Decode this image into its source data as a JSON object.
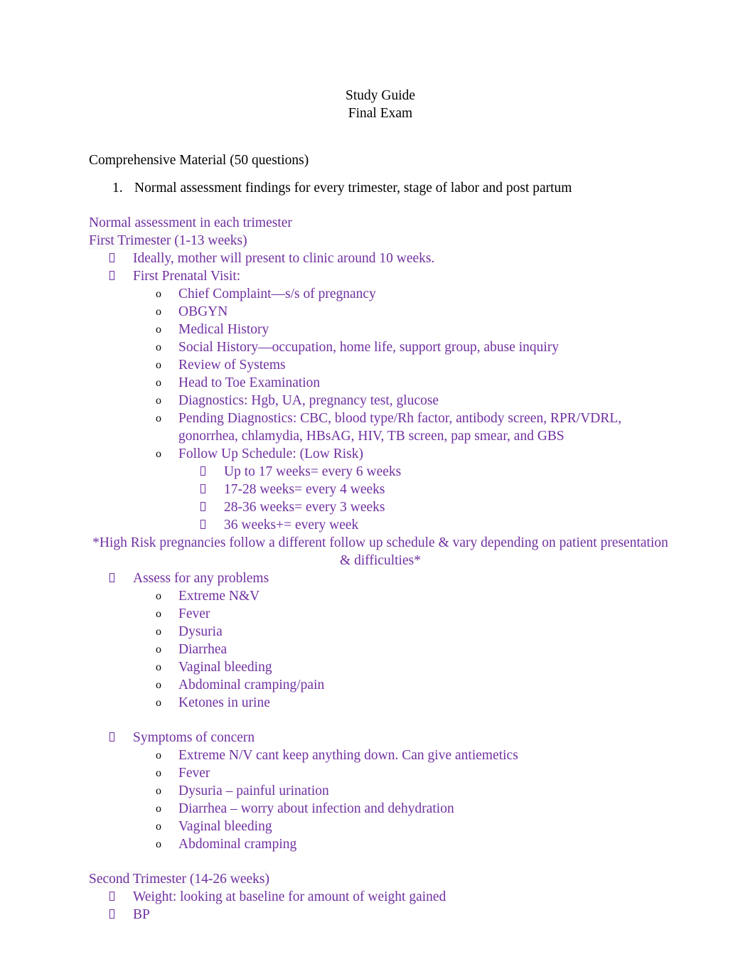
{
  "document": {
    "title_lines": [
      "Study Guide",
      "Final Exam"
    ],
    "section_heading": "Comprehensive Material (50 questions)",
    "numbered_items": [
      {
        "number": "1.",
        "text": "Normal assessment findings for every trimester, stage of labor and post partum"
      }
    ],
    "colors": {
      "body_text": "#000000",
      "purple_text": "#7030A0",
      "page_background": "#ffffff",
      "shading": "#fafafa"
    },
    "bullet_glyphs": {
      "level1": "missing-glyph-box",
      "level2": "o",
      "level3": "missing-glyph-box"
    },
    "outline": {
      "intro_heading": "Normal assessment in each trimester",
      "first_trimester": {
        "heading": "First Trimester (1-13 weeks)",
        "items": [
          {
            "level": 1,
            "text": "Ideally, mother will present to clinic around 10 weeks."
          },
          {
            "level": 1,
            "text": "First Prenatal Visit:"
          },
          {
            "level": 2,
            "text": "Chief Complaint—s/s of pregnancy"
          },
          {
            "level": 2,
            "text": "OBGYN"
          },
          {
            "level": 2,
            "text": "Medical History"
          },
          {
            "level": 2,
            "text": "Social History—occupation, home life, support group, abuse inquiry"
          },
          {
            "level": 2,
            "text": "Review of Systems"
          },
          {
            "level": 2,
            "text": "Head to Toe Examination"
          },
          {
            "level": 2,
            "text": "Diagnostics: Hgb, UA, pregnancy test, glucose"
          },
          {
            "level": 2,
            "text": "Pending Diagnostics: CBC, blood type/Rh factor, antibody screen, RPR/VDRL, gonorrhea, chlamydia, HBsAG, HIV, TB screen, pap smear, and GBS"
          },
          {
            "level": 2,
            "text": "Follow Up Schedule: (Low Risk)"
          },
          {
            "level": 3,
            "text": "Up to 17 weeks= every 6 weeks"
          },
          {
            "level": 3,
            "text": "17-28 weeks= every 4 weeks"
          },
          {
            "level": 3,
            "text": "28-36 weeks= every 3 weeks"
          },
          {
            "level": 3,
            "text": "36 weeks+= every week"
          }
        ],
        "high_risk_note": "*High Risk pregnancies follow a different follow up schedule & vary depending on patient presentation & difficulties*",
        "assess_heading": "Assess for any problems",
        "assess_items": [
          "Extreme N&V",
          "Fever",
          "Dysuria",
          "Diarrhea",
          "Vaginal bleeding",
          "Abdominal cramping/pain",
          "Ketones in urine"
        ],
        "symptoms_heading": "Symptoms of concern",
        "symptoms_items": [
          "Extreme N/V cant keep anything down. Can give antiemetics",
          "Fever",
          "Dysuria – painful urination",
          "Diarrhea – worry about infection and dehydration",
          "Vaginal bleeding",
          "Abdominal cramping"
        ]
      },
      "second_trimester": {
        "heading": "Second Trimester (14-26 weeks)",
        "items": [
          {
            "level": 1,
            "text": "Weight: looking at baseline for amount of weight gained"
          },
          {
            "level": 1,
            "text": "BP"
          }
        ]
      }
    }
  }
}
